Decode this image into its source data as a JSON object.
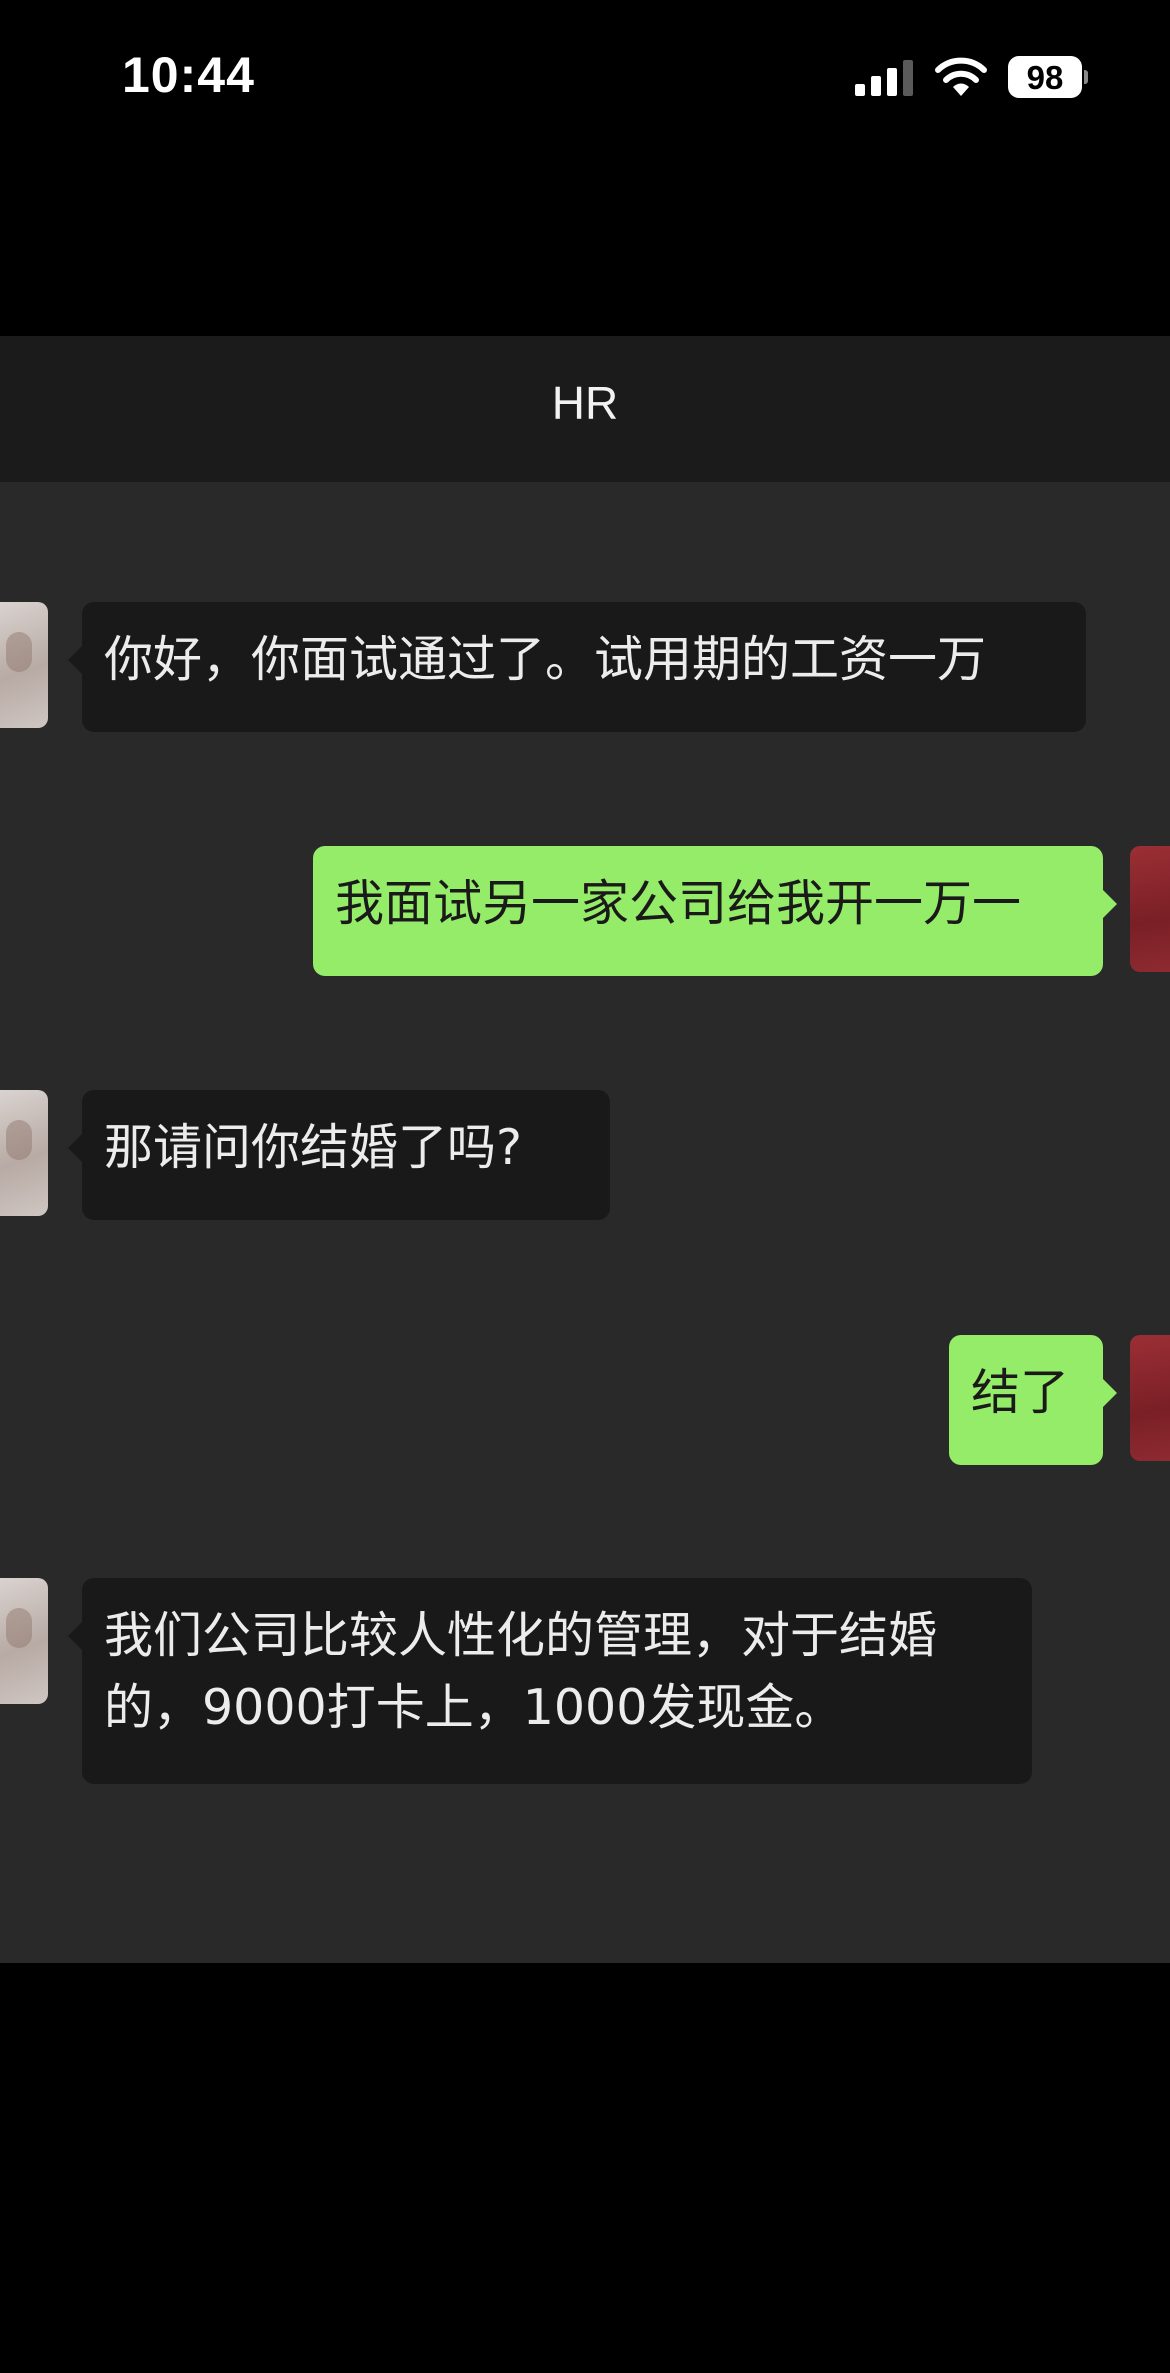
{
  "status_bar": {
    "time": "10:44",
    "battery_level": "98",
    "icons": [
      "signal-icon",
      "wifi-icon",
      "battery-icon"
    ]
  },
  "chat": {
    "title": "HR",
    "messages": [
      {
        "sender": "HR",
        "direction": "incoming",
        "text": "你好，你面试通过了。试用期的工资一万"
      },
      {
        "sender": "me",
        "direction": "outgoing",
        "text": "我面试另一家公司给我开一万一"
      },
      {
        "sender": "HR",
        "direction": "incoming",
        "text": "那请问你结婚了吗?"
      },
      {
        "sender": "me",
        "direction": "outgoing",
        "text": "结了"
      },
      {
        "sender": "HR",
        "direction": "incoming",
        "text": "我们公司比较人性化的管理，对于结婚的，9000打卡上，1000发现金。"
      }
    ]
  },
  "colors": {
    "incoming_bubble": "#191919",
    "outgoing_bubble": "#95ec69",
    "chat_background": "#292929",
    "nav_background": "#1b1b1b"
  }
}
